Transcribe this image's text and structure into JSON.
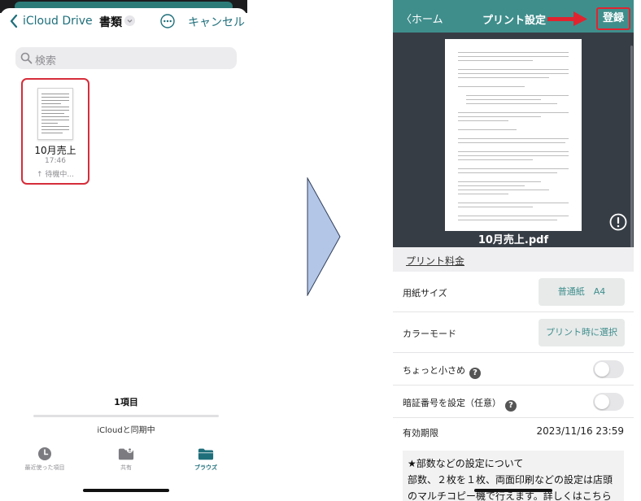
{
  "left": {
    "nav": {
      "back_label": "iCloud Drive",
      "folder_title": "書類",
      "cancel_label": "キャンセル"
    },
    "search": {
      "placeholder": "検索"
    },
    "file": {
      "name": "10月売上",
      "time": "17:46",
      "status": "↑ 待機中..."
    },
    "footer": {
      "item_count": "1項目",
      "sync_text": "iCloudと同期中"
    },
    "tabs": [
      {
        "label": "最近使った項目",
        "icon": "clock-icon"
      },
      {
        "label": "共有",
        "icon": "shared-folder-icon"
      },
      {
        "label": "ブラウズ",
        "icon": "folder-icon",
        "active": true
      }
    ],
    "accent_color": "#1f6f7b"
  },
  "right": {
    "header": {
      "back_label": "〈ホーム",
      "title": "プリント設定",
      "register_label": "登録"
    },
    "preview": {
      "document_name": "10月売上.pdf"
    },
    "price_link": "プリント料金",
    "settings": {
      "paper_size": {
        "label": "用紙サイズ",
        "value": "普通紙　A4"
      },
      "color_mode": {
        "label": "カラーモード",
        "value": "プリント時に選択"
      },
      "slightly_smaller": {
        "label": "ちょっと小さめ",
        "on": false
      },
      "pin": {
        "label": "暗証番号を設定（任意）",
        "on": false
      },
      "expiry": {
        "label": "有効期限",
        "value": "2023/11/16 23:59"
      }
    },
    "note": {
      "title": "★部数などの設定について",
      "body": "部数、２枚を１枚、両面印刷などの設定は店頭のマルチコピー機で行えます。詳しくはこちら"
    },
    "header_color": "#3f8e8c",
    "highlight_color": "#e0242f"
  }
}
